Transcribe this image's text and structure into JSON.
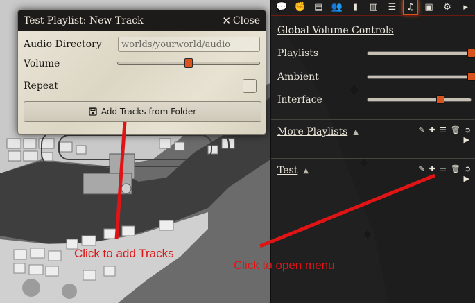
{
  "dialog": {
    "title": "Test Playlist: New Track",
    "close_label": "Close",
    "fields": {
      "audio_directory_label": "Audio Directory",
      "audio_directory_value": "worlds/yourworld/audio",
      "volume_label": "Volume",
      "volume_level": 0.5,
      "repeat_label": "Repeat",
      "repeat_checked": false
    },
    "add_button_label": "Add Tracks from Folder"
  },
  "sidebar": {
    "tabs": [
      {
        "name": "chat",
        "icon": "chat-icon"
      },
      {
        "name": "combat",
        "icon": "fist-icon"
      },
      {
        "name": "scenes",
        "icon": "map-icon"
      },
      {
        "name": "actors",
        "icon": "users-icon"
      },
      {
        "name": "items",
        "icon": "suitcase-icon"
      },
      {
        "name": "journal",
        "icon": "book-icon"
      },
      {
        "name": "tables",
        "icon": "table-icon"
      },
      {
        "name": "playlists",
        "icon": "music-icon",
        "active": true
      },
      {
        "name": "compendium",
        "icon": "atlas-icon"
      },
      {
        "name": "settings",
        "icon": "cogs-icon"
      },
      {
        "name": "collapse",
        "icon": "caret-right-icon"
      }
    ],
    "global_volume_title": "Global Volume Controls",
    "volume_controls": [
      {
        "label": "Playlists",
        "level": 1.0
      },
      {
        "label": "Ambient",
        "level": 1.0
      },
      {
        "label": "Interface",
        "level": 0.7
      }
    ],
    "playlists": [
      {
        "name": "More Playlists"
      },
      {
        "name": "Test"
      }
    ],
    "accent_color": "#d9531e"
  },
  "annotations": {
    "add_tracks": "Click to add Tracks",
    "open_menu": "Click to open menu",
    "color": "#e01414"
  }
}
